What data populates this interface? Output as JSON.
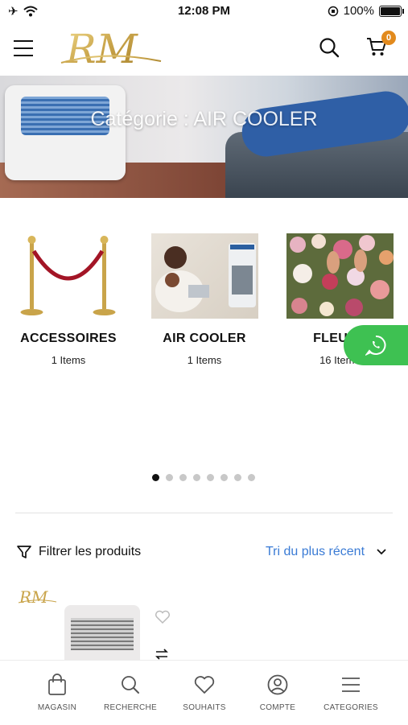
{
  "status": {
    "time": "12:08 PM",
    "battery": "100%"
  },
  "header": {
    "logo_text": "RM",
    "cart_count": "0"
  },
  "hero": {
    "title": "Catégorie : AIR COOLER"
  },
  "categories": [
    {
      "name": "ACCESSOIRES",
      "count": "1 Items"
    },
    {
      "name": "AIR COOLER",
      "count": "1 Items"
    },
    {
      "name": "FLEURS",
      "count": "16 Items"
    }
  ],
  "pagination": {
    "total": 8,
    "active": 0
  },
  "toolbar": {
    "filter_label": "Filtrer les produits",
    "sort_value": "Tri du plus récent"
  },
  "product": {
    "logo_text": "RM"
  },
  "tabs": [
    {
      "label": "MAGASIN",
      "icon": "bag-icon"
    },
    {
      "label": "RECHERCHE",
      "icon": "search-icon"
    },
    {
      "label": "SOUHAITS",
      "icon": "heart-icon"
    },
    {
      "label": "COMPTE",
      "icon": "account-icon"
    },
    {
      "label": "CATEGORIES",
      "icon": "menu-icon"
    }
  ],
  "colors": {
    "accent": "#3a7bd5",
    "badge": "#e28a1d",
    "whatsapp": "#3ec152",
    "gold": "#c9a44a"
  }
}
